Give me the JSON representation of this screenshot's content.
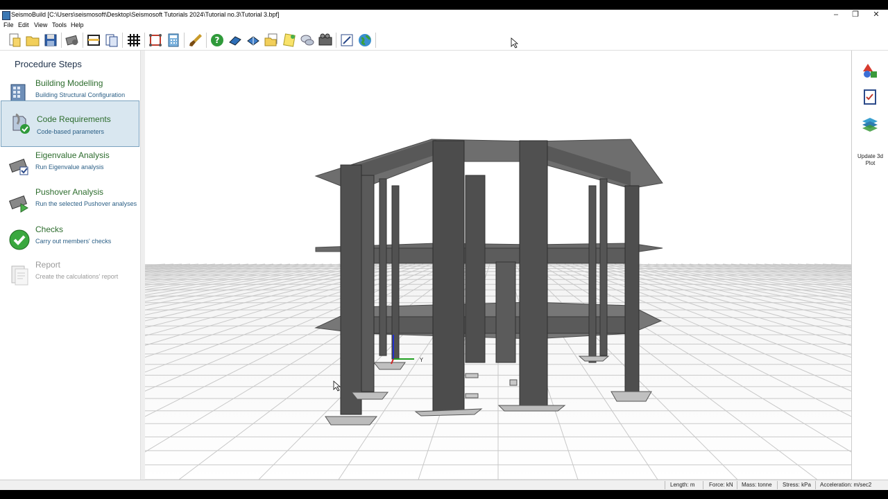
{
  "window": {
    "title": "SeismoBuild   [C:\\Users\\seismosoft\\Desktop\\Seismosoft Tutorials 2024\\Tutorial no.3\\Tutorial 3.bpf]",
    "minimize": "–",
    "restore": "❐",
    "close": "✕"
  },
  "menu": [
    "File",
    "Edit",
    "View",
    "Tools",
    "Help"
  ],
  "toolbar": {
    "icons": [
      "new-file-icon",
      "open-folder-icon",
      "save-icon",
      "settings-gear-icon",
      "frame-icon",
      "report-pages-icon",
      "grid-icon",
      "model-icon",
      "calculator-icon",
      "brush-icon",
      "help-icon",
      "book-blue-icon",
      "book-icon",
      "folder-docs-icon",
      "notes-icon",
      "chat-icon",
      "film-icon",
      "edit-icon",
      "globe-icon"
    ]
  },
  "procedure": {
    "heading": "Procedure Steps",
    "steps": [
      {
        "title": "Building Modelling",
        "desc": "Building Structural Configuration",
        "icon": "building-icon"
      },
      {
        "title": "Code Requirements",
        "desc": "Code-based parameters",
        "icon": "code-requirements-icon"
      },
      {
        "title": "Eigenvalue Analysis",
        "desc": "Run Eigenvalue analysis",
        "icon": "eigenvalue-icon"
      },
      {
        "title": "Pushover Analysis",
        "desc": "Run the selected Pushover analyses",
        "icon": "pushover-icon"
      },
      {
        "title": "Checks",
        "desc": "Carry out members' checks",
        "icon": "checks-icon"
      },
      {
        "title": "Report",
        "desc": "Create the calculations' report",
        "icon": "report-icon"
      }
    ],
    "selected_index": 1
  },
  "rightpanel": {
    "icons": [
      "shapes-icon",
      "checklist-icon",
      "layers-icon"
    ],
    "update_label_1": "Update 3d",
    "update_label_2": "Plot"
  },
  "axes_labels": {
    "y": "Y"
  },
  "statusbar": {
    "length": "Length: m",
    "force": "Force: kN",
    "mass": "Mass: tonne",
    "stress": "Stress: kPa",
    "acceleration": "Acceleration: m/sec2"
  },
  "colors": {
    "accent_green": "#2d6c2d",
    "accent_blue": "#2b5f86",
    "selected_bg": "#d9e7f0"
  }
}
